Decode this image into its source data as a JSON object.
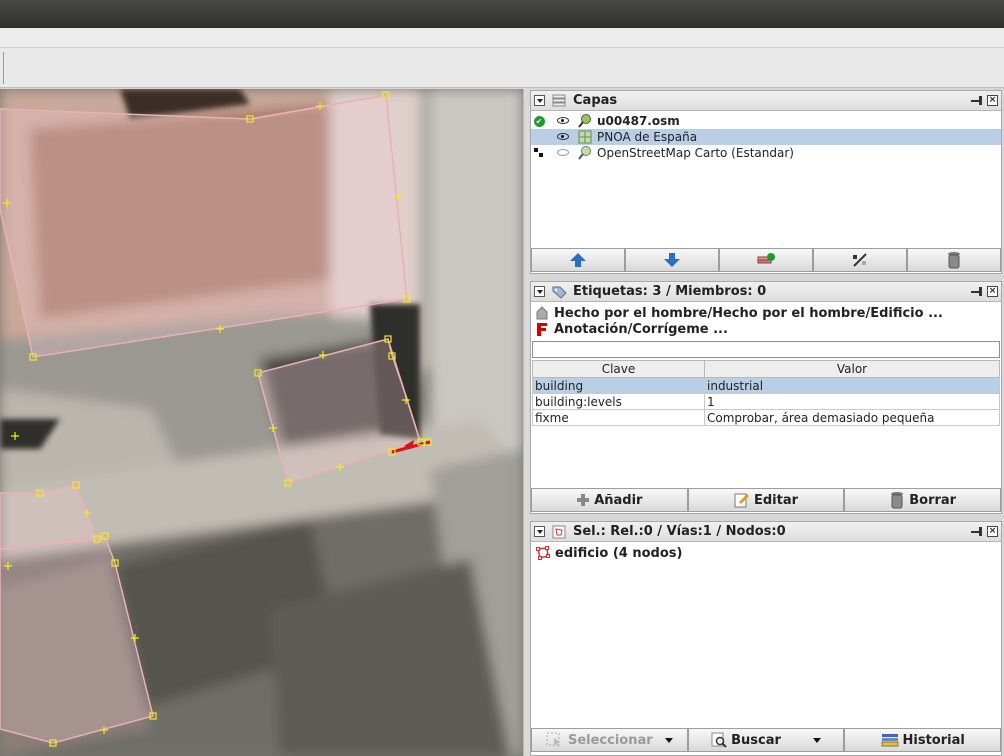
{
  "layers_panel": {
    "title": "Capas",
    "layers": [
      {
        "name": "u00487.osm",
        "bold": true,
        "active": true,
        "visible": true,
        "selected": false
      },
      {
        "name": "PNOA de España",
        "bold": false,
        "active": false,
        "visible": true,
        "selected": true
      },
      {
        "name": "OpenStreetMap Carto (Estandar)",
        "bold": false,
        "active": false,
        "visible": false,
        "selected": false
      }
    ],
    "buttons": [
      "move-up",
      "move-down",
      "activate",
      "opacity",
      "delete"
    ]
  },
  "tags_panel": {
    "title": "Etiquetas: 3 / Miembros: 0",
    "presets": [
      {
        "label": "Hecho por el hombre/Hecho por el hombre/Edificio ...",
        "icon": "building-preset-icon"
      },
      {
        "label": "Anotación/Corrígeme ...",
        "icon": "fixme-preset-icon"
      }
    ],
    "filter_value": "",
    "columns": {
      "key": "Clave",
      "value": "Valor"
    },
    "rows": [
      {
        "key": "building",
        "value": "industrial",
        "selected": true
      },
      {
        "key": "building:levels",
        "value": "1",
        "selected": false
      },
      {
        "key": "fixme",
        "value": "Comprobar, área demasiado pequeña",
        "selected": false
      }
    ],
    "add_label": "Añadir",
    "edit_label": "Editar",
    "delete_label": "Borrar"
  },
  "selection_panel": {
    "title": "Sel.: Rel.:0 / Vías:1 / Nodos:0",
    "items": [
      {
        "label": "edificio (4 nodos)"
      }
    ],
    "select_label": "Seleccionar",
    "search_label": "Buscar",
    "history_label": "Historial"
  },
  "colors": {
    "selection_highlight": "#b8cfe5",
    "fixme_red": "#d40000",
    "active_green": "#1f9a2e",
    "way_pink": "#e8a7b0",
    "node_yellow": "#f5ea1f"
  }
}
